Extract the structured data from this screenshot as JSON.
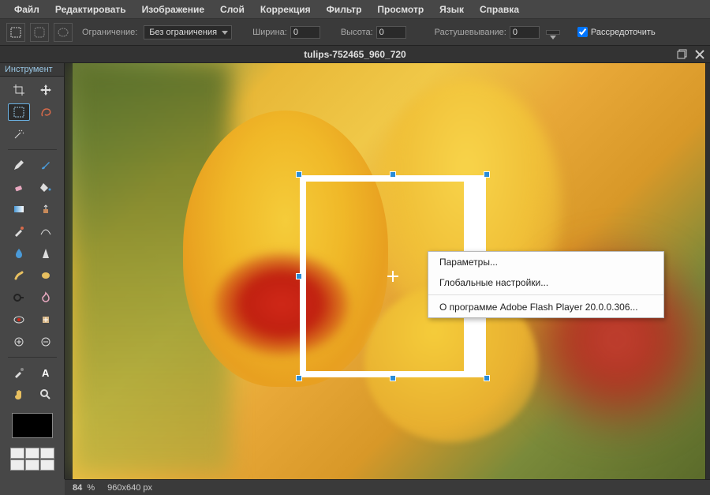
{
  "menubar": {
    "file": "Файл",
    "edit": "Редактировать",
    "image": "Изображение",
    "layer": "Слой",
    "adjust": "Коррекция",
    "filter": "Фильтр",
    "view": "Просмотр",
    "language": "Язык",
    "help": "Справка"
  },
  "options": {
    "constraint_label": "Ограничение:",
    "constraint_value": "Без ограничения",
    "width_label": "Ширина:",
    "width_value": "0",
    "height_label": "Высота:",
    "height_value": "0",
    "feather_label": "Растушевывание:",
    "feather_value": "0",
    "scatter_label": "Рассредоточить"
  },
  "document": {
    "title": "tulips-752465_960_720"
  },
  "toolbox": {
    "panel_title": "Инструмент"
  },
  "context_menu": {
    "params": "Параметры...",
    "global": "Глобальные настройки...",
    "about": "О программе Adobe Flash Player 20.0.0.306..."
  },
  "status": {
    "zoom": "84",
    "zoom_unit": "%",
    "dimensions": "960x640 px"
  }
}
